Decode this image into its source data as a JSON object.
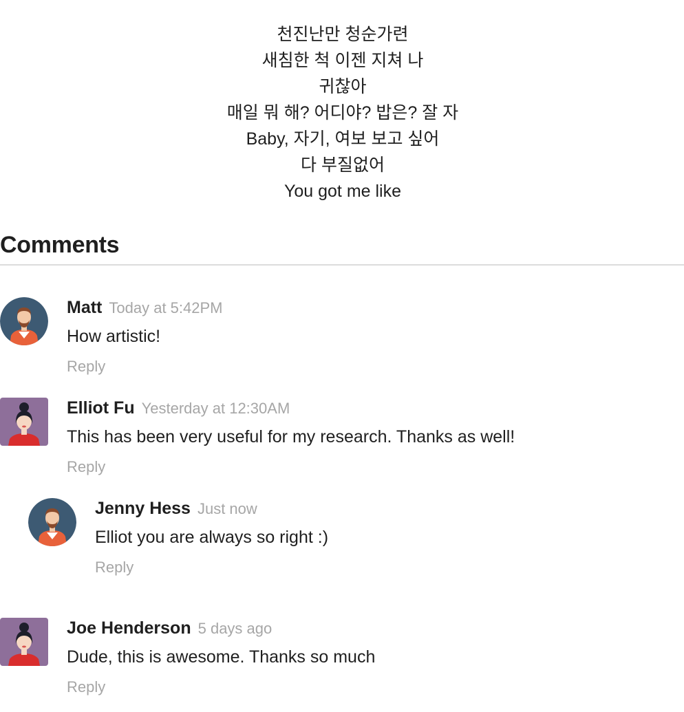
{
  "lyrics": [
    "천진난만 청순가련",
    "새침한 척 이젠 지쳐 나",
    "귀찮아",
    "매일 뭐 해? 어디야? 밥은? 잘 자",
    "Baby, 자기, 여보 보고 싶어",
    "다 부질없어",
    "You got me like"
  ],
  "comments_title": "Comments",
  "comments": [
    {
      "author": "Matt",
      "date": "Today at 5:42PM",
      "text": "How artistic!",
      "reply_label": "Reply",
      "avatar": "male-avatar-icon"
    },
    {
      "author": "Elliot Fu",
      "date": "Yesterday at 12:30AM",
      "text": "This has been very useful for my research. Thanks as well!",
      "reply_label": "Reply",
      "avatar": "female-avatar-icon",
      "replies": [
        {
          "author": "Jenny Hess",
          "date": "Just now",
          "text": "Elliot you are always so right :)",
          "reply_label": "Reply",
          "avatar": "male-avatar-icon"
        }
      ]
    },
    {
      "author": "Joe Henderson",
      "date": "5 days ago",
      "text": "Dude, this is awesome. Thanks so much",
      "reply_label": "Reply",
      "avatar": "female-avatar-icon"
    }
  ],
  "colors": {
    "text": "#1f1f1f",
    "muted": "#a6a6a6",
    "divider": "#dcdcdc",
    "avatar_male_bg": "#3d5a73",
    "avatar_female_bg": "#8e6f9a",
    "shirt_orange": "#e8613a",
    "shirt_red": "#d92d2d"
  }
}
